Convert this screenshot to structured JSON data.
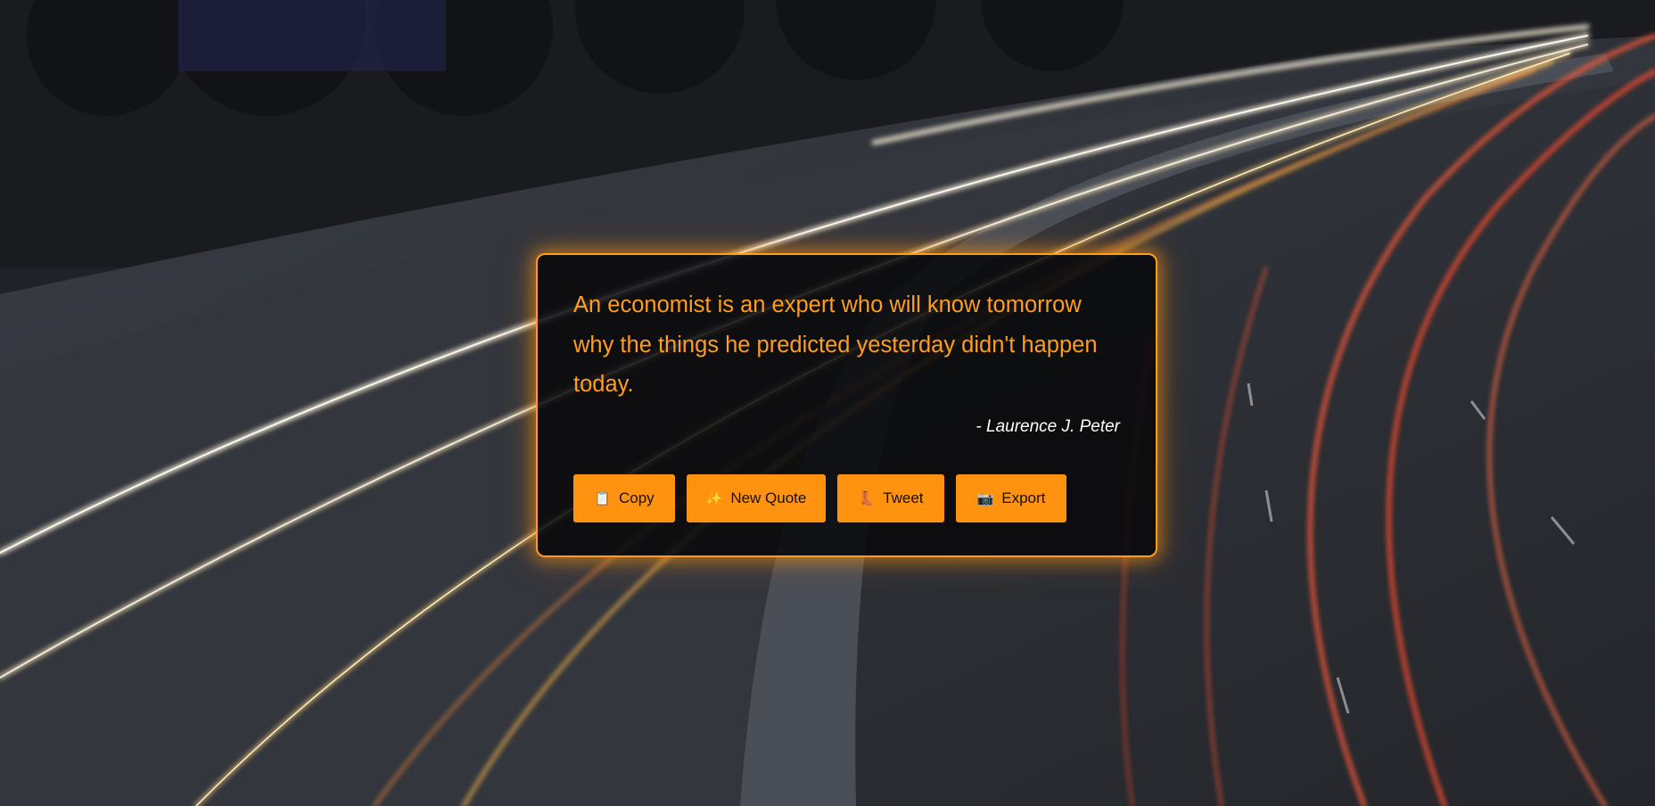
{
  "quote": {
    "text": "An economist is an expert who will know tomorrow why the things he predicted yesterday didn't happen today.",
    "author": "- Laurence J. Peter"
  },
  "actions": [
    {
      "label": "Copy",
      "icon": "clipboard-icon",
      "glyph": "📋"
    },
    {
      "label": "New Quote",
      "icon": "sparkles-icon",
      "glyph": "✨"
    },
    {
      "label": "Tweet",
      "icon": "boot-icon",
      "glyph": "👢"
    },
    {
      "label": "Export",
      "icon": "camera-icon",
      "glyph": "📷"
    }
  ],
  "colors": {
    "accent": "#ff9c1a",
    "button": "#ff920f",
    "card_background": "#0a0a0c",
    "author": "#ffffff"
  },
  "background": {
    "description_icon": "night-highway-light-trails-photo"
  }
}
